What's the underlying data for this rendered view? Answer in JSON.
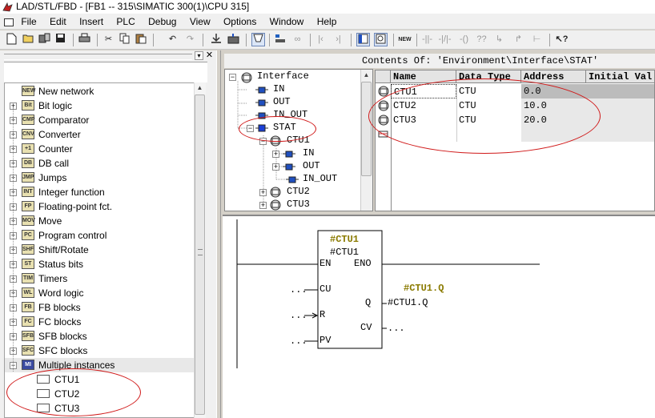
{
  "titlebar": {
    "title": "LAD/STL/FBD  - [FB1 -- 315\\SIMATIC 300(1)\\CPU 315]"
  },
  "menu": [
    "File",
    "Edit",
    "Insert",
    "PLC",
    "Debug",
    "View",
    "Options",
    "Window",
    "Help"
  ],
  "toolbar_icons": [
    "new-icon",
    "open-icon",
    "go-online-icon",
    "save-icon",
    "print-icon",
    "cut-icon",
    "copy-icon",
    "paste-icon",
    "undo-icon",
    "redo-icon",
    "download-icon",
    "upload-icon",
    "monitor-icon",
    "module-info-icon",
    "glasses-icon",
    "jump-back-icon",
    "jump-forward-icon",
    "overview-icon",
    "program-elements-icon",
    "network-icon",
    "normally-open-icon",
    "normally-closed-icon",
    "coil-icon",
    "box-icon",
    "branch-open-icon",
    "branch-close-icon",
    "connect-icon",
    "help-icon"
  ],
  "catalog": {
    "items": [
      {
        "label": "New network",
        "icon": "NEW",
        "expandable": false
      },
      {
        "label": "Bit logic",
        "icon": "Bit",
        "expandable": true
      },
      {
        "label": "Comparator",
        "icon": "CMP",
        "expandable": true
      },
      {
        "label": "Converter",
        "icon": "CNV",
        "expandable": true
      },
      {
        "label": "Counter",
        "icon": "+1",
        "expandable": true
      },
      {
        "label": "DB call",
        "icon": "DB",
        "expandable": true
      },
      {
        "label": "Jumps",
        "icon": "JMP",
        "expandable": true
      },
      {
        "label": "Integer function",
        "icon": "INT",
        "expandable": true
      },
      {
        "label": "Floating-point fct.",
        "icon": "FP",
        "expandable": true
      },
      {
        "label": "Move",
        "icon": "MOV",
        "expandable": true
      },
      {
        "label": "Program control",
        "icon": "PC",
        "expandable": true
      },
      {
        "label": "Shift/Rotate",
        "icon": "SHF",
        "expandable": true
      },
      {
        "label": "Status bits",
        "icon": "ST",
        "expandable": true
      },
      {
        "label": "Timers",
        "icon": "TIM",
        "expandable": true
      },
      {
        "label": "Word logic",
        "icon": "WL",
        "expandable": true
      },
      {
        "label": "FB blocks",
        "icon": "FB",
        "expandable": true
      },
      {
        "label": "FC blocks",
        "icon": "FC",
        "expandable": true
      },
      {
        "label": "SFB blocks",
        "icon": "SFB",
        "expandable": true
      },
      {
        "label": "SFC blocks",
        "icon": "SFC",
        "expandable": true
      },
      {
        "label": "Multiple instances",
        "icon": "MI",
        "expandable": true,
        "expanded": true
      }
    ],
    "instances": [
      "CTU1",
      "CTU2",
      "CTU3"
    ]
  },
  "interface_tree": {
    "root": "Interface",
    "params": [
      "IN",
      "OUT",
      "IN_OUT"
    ],
    "stat": "STAT",
    "stat_children": [
      "CTU1",
      "CTU2",
      "CTU3"
    ],
    "ctu1_children": [
      "IN",
      "OUT",
      "IN_OUT"
    ]
  },
  "contents_of": "Contents Of: 'Environment\\Interface\\STAT'",
  "table": {
    "headers": [
      "Name",
      "Data Type",
      "Address",
      "Initial Val"
    ],
    "rows": [
      {
        "name": "CTU1",
        "type": "CTU",
        "address": "0.0"
      },
      {
        "name": "CTU2",
        "type": "CTU",
        "address": "10.0"
      },
      {
        "name": "CTU3",
        "type": "CTU",
        "address": "20.0"
      }
    ]
  },
  "ladder": {
    "instance_label": "#CTU1",
    "block_type": "#CTU1",
    "en": "EN",
    "eno": "ENO",
    "cu": "CU",
    "r": "R",
    "pv": "PV",
    "q": "Q",
    "cv": "CV",
    "q_label": "#CTU1.Q",
    "q_var": "#CTU1.Q",
    "cu_in": "...",
    "r_in": "...",
    "pv_in": "...",
    "cv_out": "..."
  },
  "colors": {
    "annotation": "#d01818",
    "stat_icon": "#1a3fd6",
    "instance_name": "#8a7a00"
  }
}
